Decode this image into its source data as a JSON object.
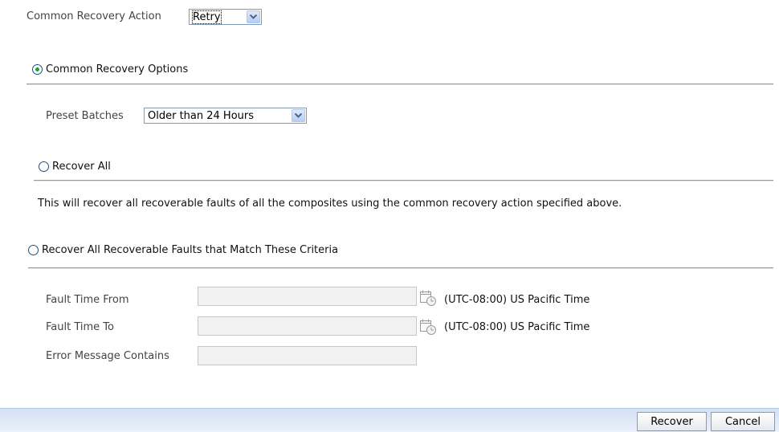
{
  "common_action": {
    "label": "Common Recovery Action",
    "selected": "Retry"
  },
  "options": {
    "common": {
      "label": "Common Recovery Options",
      "selected": true,
      "preset_label": "Preset Batches",
      "preset_selected": "Older than 24 Hours"
    },
    "recover_all": {
      "label": "Recover All",
      "selected": false,
      "description": "This will recover all recoverable faults of all the composites using the common recovery action specified above."
    },
    "criteria": {
      "label": "Recover All Recoverable Faults that Match These Criteria",
      "selected": false,
      "fault_time_from_label": "Fault Time From",
      "fault_time_from_value": "",
      "fault_time_to_label": "Fault Time To",
      "fault_time_to_value": "",
      "error_message_label": "Error Message Contains",
      "error_message_value": "",
      "timezone": "(UTC-08:00) US Pacific Time"
    }
  },
  "footer": {
    "recover_label": "Recover",
    "cancel_label": "Cancel"
  },
  "icons": {
    "calendar": "calendar-icon",
    "dropdown": "chevron-down-icon"
  }
}
